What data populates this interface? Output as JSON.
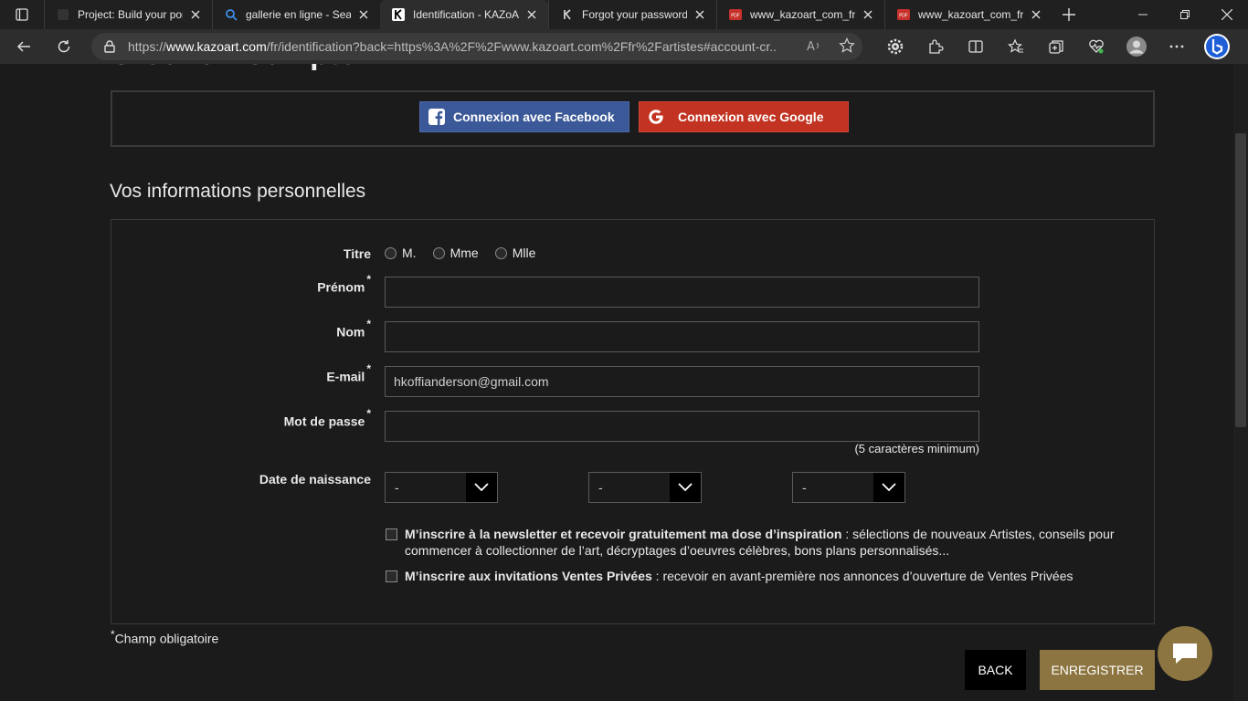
{
  "browser": {
    "tabs": [
      {
        "label": "Project: Build your por",
        "icon": "generic-page-icon",
        "active": false
      },
      {
        "label": "gallerie en ligne - Sear",
        "icon": "search-icon",
        "active": false
      },
      {
        "label": "Identification - KAZoA",
        "icon": "kazoart-k-icon",
        "active": true
      },
      {
        "label": "Forgot your password",
        "icon": "kazoart-k-icon",
        "active": false
      },
      {
        "label": "www_kazoart_com_fr_",
        "icon": "pdf-icon",
        "active": false
      },
      {
        "label": "www_kazoart_com_fr_",
        "icon": "pdf-icon",
        "active": false
      }
    ],
    "url_prefix": "https://",
    "url_host": "www.kazoart.com",
    "url_path": "/fr/identification?back=https%3A%2F%2Fwww.kazoart.com%2Ffr%2Fartistes#account-cr..."
  },
  "page": {
    "cut_title": "Créer un compte",
    "social": {
      "facebook_label": "Connexion avec Facebook",
      "google_label": "Connexion avec Google",
      "facebook_color": "#3b5998",
      "google_color": "#c23321"
    },
    "section_title": "Vos informations personnelles",
    "form": {
      "titre_label": "Titre",
      "titre_options": [
        "M.",
        "Mme",
        "Mlle"
      ],
      "prenom_label": "Prénom",
      "nom_label": "Nom",
      "email_label": "E-mail",
      "email_value": "hkoffianderson@gmail.com",
      "password_label": "Mot de passe",
      "password_hint": "(5 caractères minimum)",
      "dob_label": "Date de naissance",
      "dob_day": "-",
      "dob_month": "-",
      "dob_year": "-",
      "required_mark": "*",
      "newsletter_bold": "M’inscrire à la newsletter et recevoir gratuitement ma dose d’inspiration",
      "newsletter_rest": " : sélections de nouveaux Artistes, conseils pour commencer à collectionner de l’art, décryptages d’oeuvres célèbres, bons plans personnalisés...",
      "ventes_bold": "M’inscrire aux invitations Ventes Privées",
      "ventes_rest": " : recevoir en avant-première nos annonces d’ouverture de Ventes Privées"
    },
    "required_note": "Champ obligatoire",
    "back_label": "BACK",
    "save_label": "ENREGISTRER",
    "accent_color": "#8c7540"
  }
}
